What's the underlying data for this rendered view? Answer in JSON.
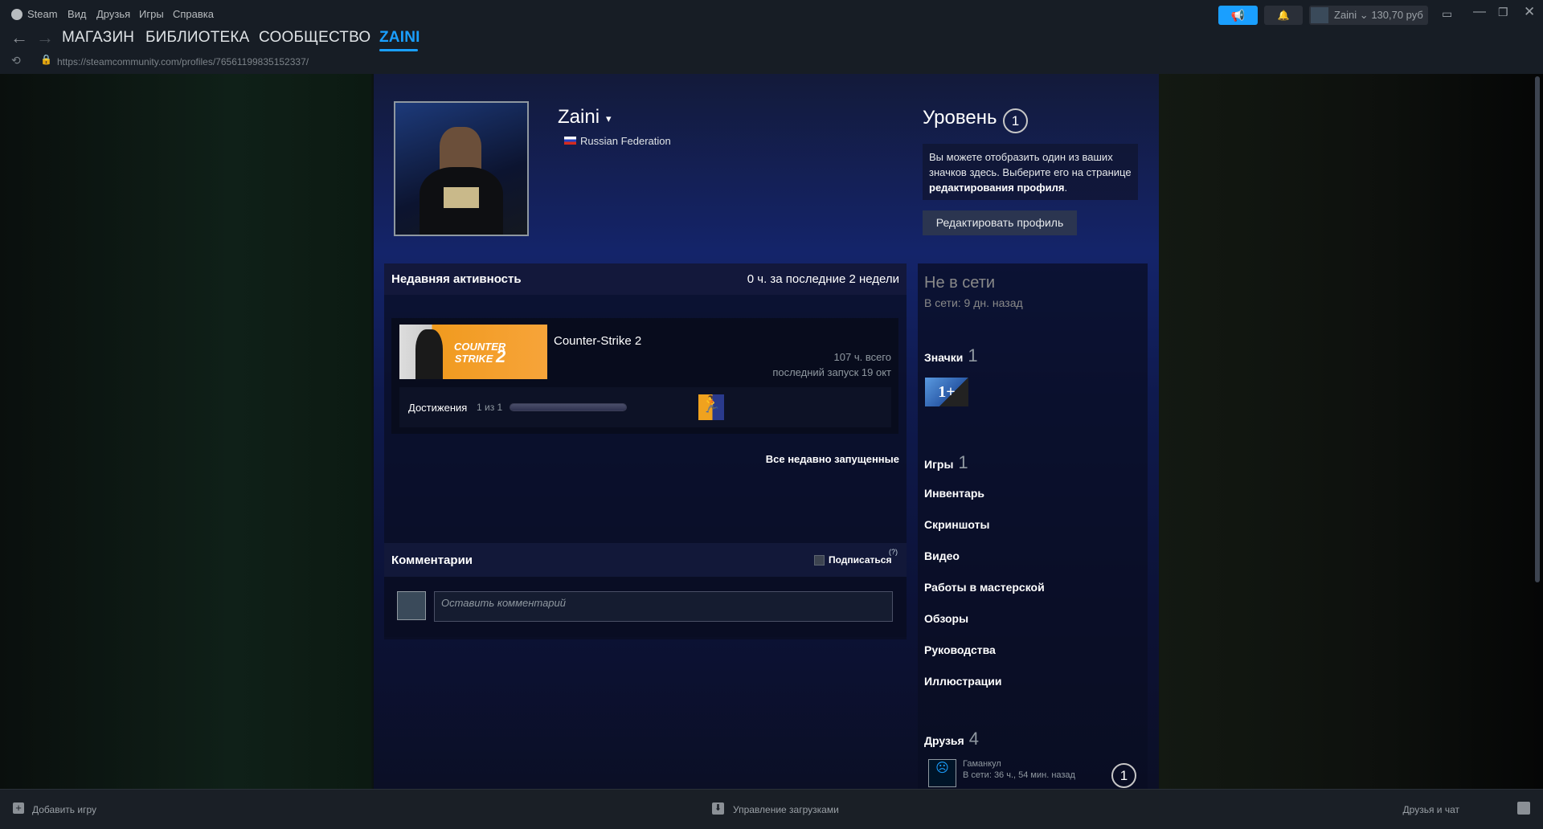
{
  "menu": {
    "steam": "Steam",
    "view": "Вид",
    "friends": "Друзья",
    "games": "Игры",
    "help": "Справка"
  },
  "nav": {
    "store": "МАГАЗИН",
    "library": "БИБЛИОТЕКА",
    "community": "СООБЩЕСТВО",
    "user": "ZAINI"
  },
  "url": "https://steamcommunity.com/profiles/76561199835152337/",
  "account": {
    "name": "Zaini",
    "balance": "130,70 руб"
  },
  "profile": {
    "name": "Zaini",
    "country": "Russian Federation",
    "level_label": "Уровень",
    "level": "1",
    "badge_info_1": "Вы можете отобразить один из ваших значков здесь. Выберите его на странице ",
    "badge_info_link": "редактирования профиля",
    "badge_info_2": ".",
    "edit_button": "Редактировать профиль"
  },
  "activity": {
    "title": "Недавняя активность",
    "hours": "0 ч. за последние 2 недели",
    "game": {
      "name": "Counter-Strike 2",
      "logo_text": "COUNTER STRIKE 2",
      "total": "107 ч. всего",
      "last": "последний запуск 19 окт",
      "ach_label": "Достижения",
      "ach_count": "1 из 1",
      "ach_progress": 1.0
    },
    "all_link": "Все недавно запущенные"
  },
  "comments": {
    "title": "Комментарии",
    "subscribe": "Подписаться",
    "help": "(?)",
    "placeholder": "Оставить комментарий"
  },
  "side": {
    "status": "Не в сети",
    "last_online": "В сети: 9 дн. назад",
    "badges": "Значки",
    "badges_count": "1",
    "badge_text": "1+",
    "games": "Игры",
    "games_count": "1",
    "links": [
      "Инвентарь",
      "Скриншоты",
      "Видео",
      "Работы в мастерской",
      "Обзоры",
      "Руководства",
      "Иллюстрации"
    ],
    "friends": "Друзья",
    "friends_count": "4",
    "friend": {
      "name": "Гаманкул",
      "status": "В сети: 36 ч., 54 мин. назад",
      "level": "1"
    }
  },
  "bottom": {
    "add_game": "Добавить игру",
    "downloads": "Управление загрузками",
    "friends_chat": "Друзья и чат"
  }
}
